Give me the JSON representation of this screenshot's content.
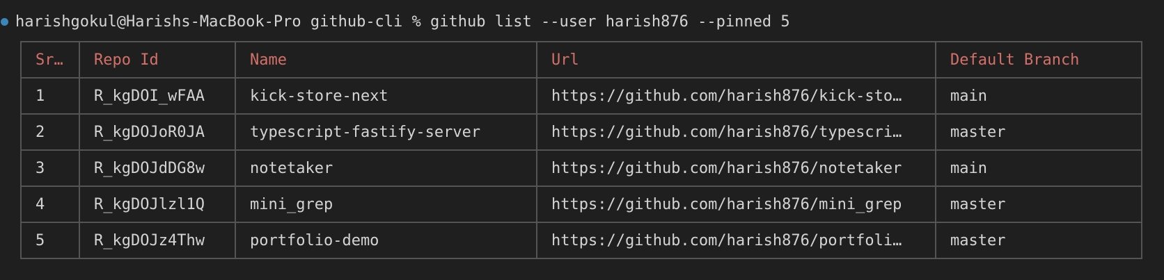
{
  "terminal": {
    "status_dot_color": "#3a86b8",
    "prompt": "harishgokul@Harishs-MacBook-Pro github-cli % ",
    "command": "github list --user harish876 --pinned 5"
  },
  "table": {
    "header_color": "#d57068",
    "headers": {
      "sr": "Sr…",
      "repo_id": "Repo Id",
      "name": "Name",
      "url": "Url",
      "default_branch": "Default Branch"
    },
    "rows": [
      {
        "sr": "1",
        "repo_id": "R_kgDOI_wFAA",
        "name": "kick-store-next",
        "url": "https://github.com/harish876/kick-sto…",
        "default_branch": "main"
      },
      {
        "sr": "2",
        "repo_id": "R_kgDOJoR0JA",
        "name": "typescript-fastify-server",
        "url": "https://github.com/harish876/typescri…",
        "default_branch": "master"
      },
      {
        "sr": "3",
        "repo_id": "R_kgDOJdDG8w",
        "name": "notetaker",
        "url": "https://github.com/harish876/notetaker",
        "default_branch": "main"
      },
      {
        "sr": "4",
        "repo_id": "R_kgDOJlzl1Q",
        "name": "mini_grep",
        "url": "https://github.com/harish876/mini_grep",
        "default_branch": "master"
      },
      {
        "sr": "5",
        "repo_id": "R_kgDOJz4Thw",
        "name": "portfolio-demo",
        "url": "https://github.com/harish876/portfoli…",
        "default_branch": "master"
      }
    ]
  }
}
